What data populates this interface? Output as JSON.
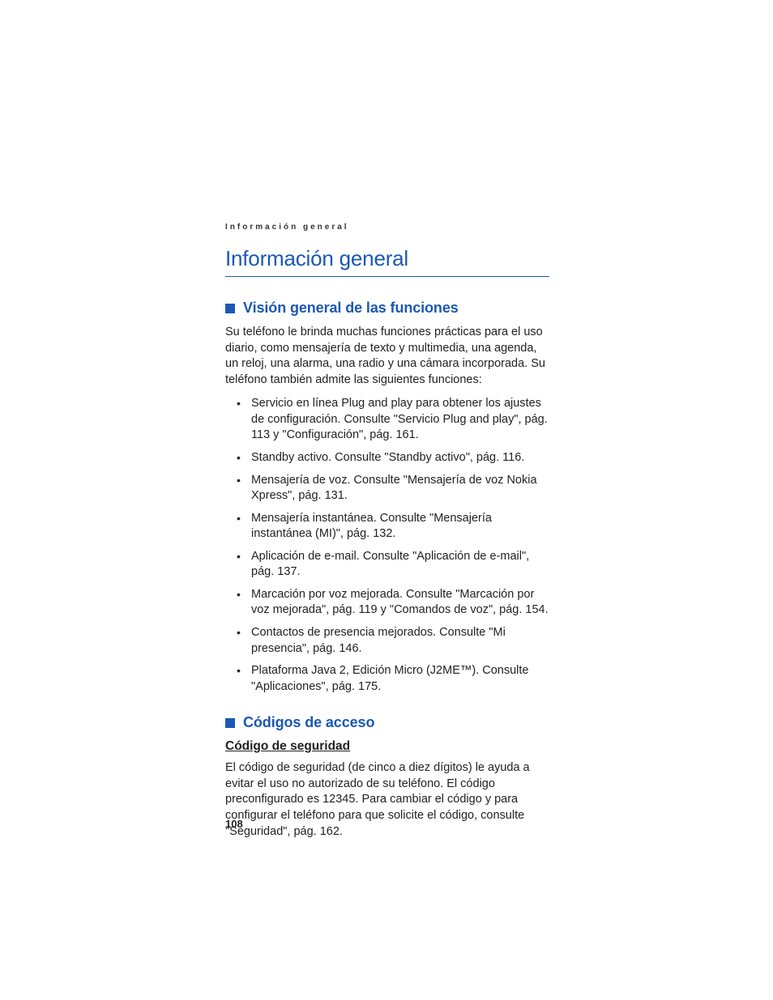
{
  "running_header": "Información general",
  "chapter_title": "Información general",
  "section1": {
    "title": "Visión general de las funciones",
    "intro": "Su teléfono le brinda muchas funciones prácticas para el uso diario, como mensajería de texto y multimedia, una agenda, un reloj, una alarma, una radio y una cámara incorporada. Su teléfono también admite las siguientes funciones:",
    "items": [
      "Servicio en línea Plug and play para obtener los ajustes de configuración. Consulte \"Servicio Plug and play\", pág. 113 y \"Configuración\", pág. 161.",
      "Standby activo. Consulte \"Standby activo\", pág. 116.",
      "Mensajería de voz. Consulte \"Mensajería de voz Nokia Xpress\", pág. 131.",
      "Mensajería instantánea. Consulte \"Mensajería instantánea (MI)\", pág. 132.",
      "Aplicación de e-mail. Consulte \"Aplicación de e-mail\", pág. 137.",
      "Marcación por voz mejorada. Consulte \"Marcación por voz mejorada\", pág. 119 y \"Comandos de voz\", pág. 154.",
      "Contactos de presencia mejorados. Consulte \"Mi presencia\", pág. 146.",
      "Plataforma Java 2, Edición Micro (J2ME™). Consulte \"Aplicaciones\", pág. 175."
    ]
  },
  "section2": {
    "title": "Códigos de acceso",
    "subsection_title": "Código de seguridad",
    "body": "El código de seguridad (de cinco a diez dígitos) le ayuda a evitar el uso no autorizado de su teléfono. El código preconfigurado es 12345. Para cambiar el código y para configurar el teléfono para que solicite el código, consulte \"Seguridad\", pág. 162."
  },
  "page_number": "108"
}
